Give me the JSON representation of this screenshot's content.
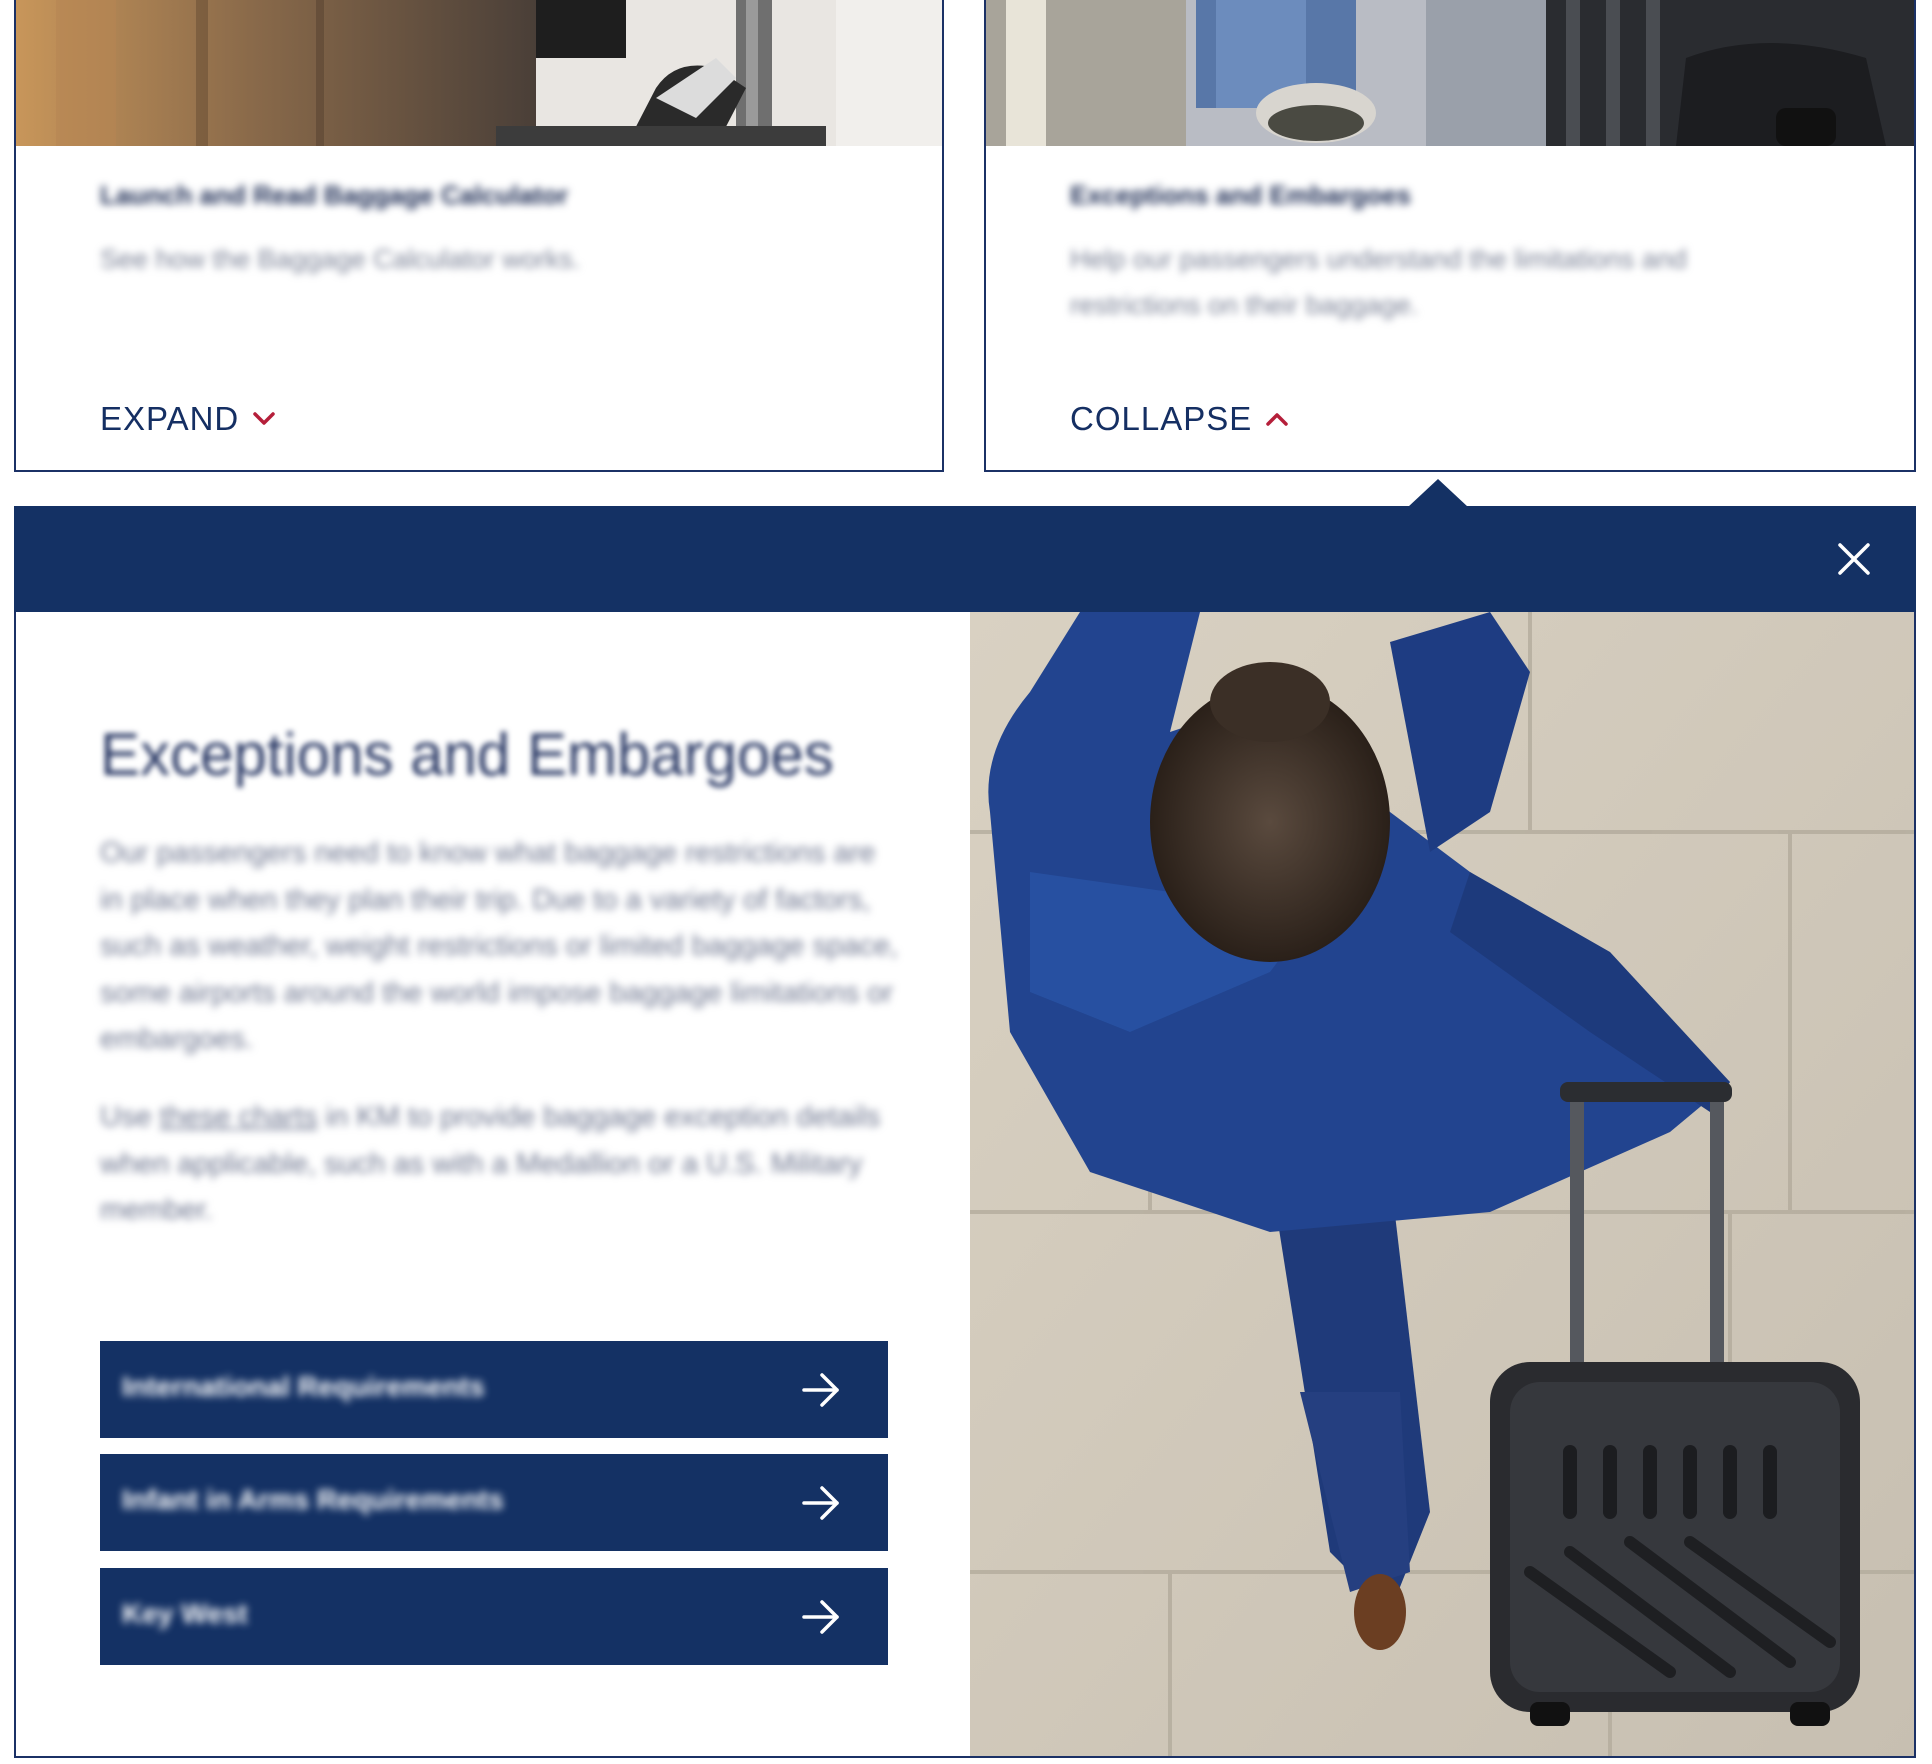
{
  "cards": [
    {
      "title": "Launch and Read Baggage Calculator",
      "description": "See how the Baggage Calculator works.",
      "toggle_label": "EXPAND",
      "toggle_icon": "chevron-down-icon"
    },
    {
      "title": "Exceptions and Embargoes",
      "description": "Help our passengers understand the limitations and restrictions on their baggage.",
      "toggle_label": "COLLAPSE",
      "toggle_icon": "chevron-up-icon"
    }
  ],
  "panel": {
    "close_icon": "close-icon",
    "heading": "Exceptions and Embargoes",
    "paragraph1": "Our passengers need to know what baggage restrictions are in place when they plan their trip. Due to a variety of factors, such as weather, weight restrictions or limited baggage space, some airports around the world impose baggage limitations or embargoes.",
    "paragraph2_prefix": "Use ",
    "paragraph2_link": "these charts",
    "paragraph2_suffix": " in KM to provide baggage exception details when applicable, such as with a Medallion or a U.S. Military member.",
    "buttons": [
      {
        "label": "International Requirements",
        "icon": "arrow-right-icon"
      },
      {
        "label": "Infant in Arms Requirements",
        "icon": "arrow-right-icon"
      },
      {
        "label": "Key West",
        "icon": "arrow-right-icon"
      }
    ]
  },
  "colors": {
    "navy": "#143164",
    "accent_red": "#b51f3a",
    "white": "#ffffff"
  }
}
